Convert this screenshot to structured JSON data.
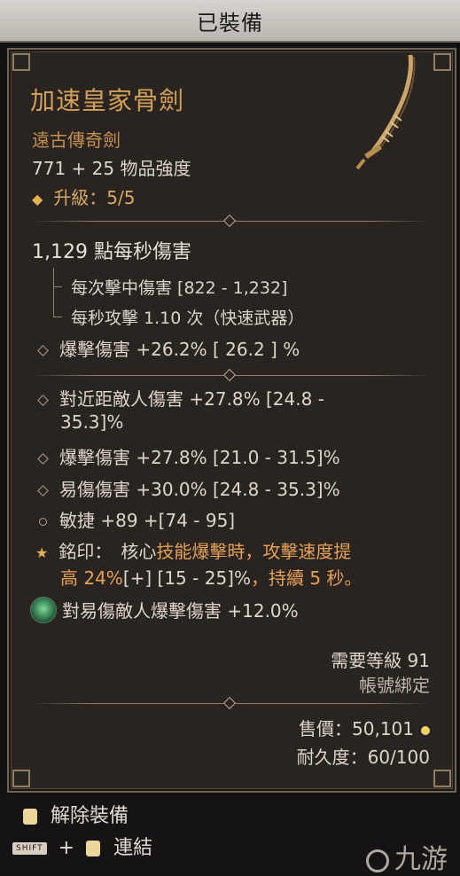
{
  "title": "已裝備",
  "item": {
    "name": "加速皇家骨劍",
    "type": "遠古傳奇劍",
    "power": "771 + 25 物品強度",
    "upgrade_icon": "diamond-icon",
    "upgrade": "升級：5/5"
  },
  "dps": {
    "main": "1,129 點每秒傷害",
    "hit": "每次擊中傷害 [822 - 1,232]",
    "attack_speed": "每秒攻擊 1.10 次（快速武器）",
    "crit": "爆擊傷害 +26.2%   [ 26.2 ] %"
  },
  "affixes": [
    {
      "line1": "對近距敵人傷害 +27.8% [24.8 -",
      "line2": "35.3]%"
    },
    {
      "line1": "爆擊傷害 +27.8% [21.0 - 31.5]%"
    },
    {
      "line1": "易傷傷害 +30.0% [24.8 - 35.3]%"
    },
    {
      "line1": "敏捷 +89 +[74 - 95]"
    }
  ],
  "aspect": {
    "prefix": "銘印：",
    "core": "核心",
    "text1": "技能爆擊時，攻擊速度提",
    "text2a": "高 24%",
    "text2b": "[+] [15 - 25]%",
    "text2c": "，持續 5 秒。"
  },
  "gem": {
    "text": "對易傷敵人爆擊傷害 +12.0%"
  },
  "requirements": {
    "level": "需要等級 91",
    "bound": "帳號綁定"
  },
  "sell": {
    "price": "售價：50,101",
    "durability": "耐久度：60/100"
  },
  "footer": {
    "unequip": "解除裝備",
    "key": "SHIFT",
    "plus": "+",
    "link": "連結",
    "logo": "九游"
  },
  "colors": {
    "name": "#d1a05a",
    "type": "#c28e52",
    "orange": "#e6a158"
  }
}
